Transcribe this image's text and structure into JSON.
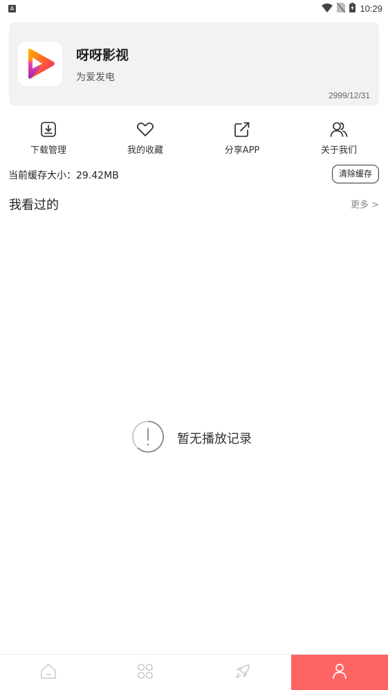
{
  "status_bar": {
    "notification_badge": "A",
    "time": "10:29",
    "icons": [
      "wifi-icon",
      "no-sim-icon",
      "battery-charging-icon"
    ]
  },
  "profile": {
    "app_name": "呀呀影视",
    "tagline": "为爱发电",
    "date": "2999/12/31",
    "logo_icon": "play-logo-icon"
  },
  "actions": [
    {
      "label": "下载管理",
      "icon": "download-icon"
    },
    {
      "label": "我的收藏",
      "icon": "heart-icon"
    },
    {
      "label": "分享APP",
      "icon": "share-icon"
    },
    {
      "label": "关于我们",
      "icon": "users-icon"
    }
  ],
  "cache": {
    "label": "当前缓存大小：29.42MB",
    "clear_button": "清除缓存"
  },
  "history": {
    "title": "我看过的",
    "more": "更多 >",
    "empty_text": "暂无播放记录",
    "empty_icon": "alert-circle-icon"
  },
  "bottom_nav": {
    "items": [
      {
        "name": "home",
        "icon": "home-icon",
        "active": false
      },
      {
        "name": "categories",
        "icon": "grid-icon",
        "active": false
      },
      {
        "name": "discover",
        "icon": "rocket-icon",
        "active": false
      },
      {
        "name": "profile",
        "icon": "user-icon",
        "active": true
      }
    ],
    "active_color": "#ff6464"
  },
  "colors": {
    "card_bg": "#f2f2f2",
    "accent": "#ff6464"
  }
}
